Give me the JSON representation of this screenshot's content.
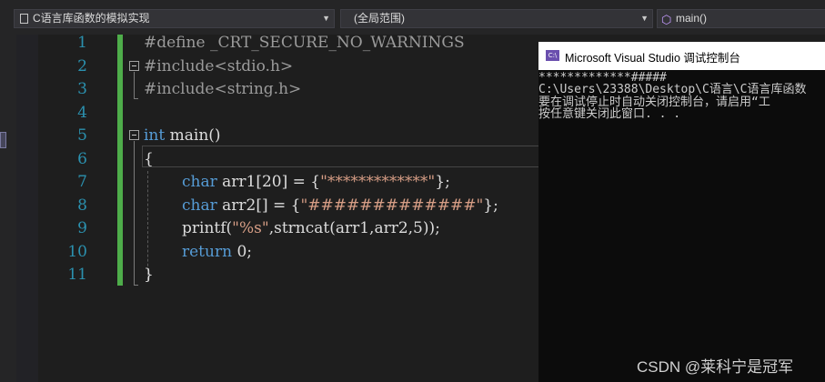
{
  "navbar": {
    "file_dropdown": "C语言库函数的模拟实现",
    "scope_dropdown": "(全局范围)",
    "function_dropdown": "main()"
  },
  "editor": {
    "line_numbers": [
      "1",
      "2",
      "3",
      "4",
      "5",
      "6",
      "7",
      "8",
      "9",
      "10",
      "11"
    ],
    "lines": {
      "l1": "#define _CRT_SECURE_NO_WARNINGS",
      "l2": "#include<stdio.h>",
      "l3": "#include<string.h>",
      "l5_kw": "int",
      "l5_rest": " main()",
      "l6": "{",
      "l7_kw": "char",
      "l7_a": " arr1[20] = {",
      "l7_str": "\"*************\"",
      "l7_b": "};",
      "l8_kw": "char",
      "l8_a": " arr2[] = {",
      "l8_str": "\"#############\"",
      "l8_b": "};",
      "l9_a": "printf(",
      "l9_str": "\"%s\"",
      "l9_b": ",strncat(arr1,arr2,5));",
      "l10_kw": "return",
      "l10_b": " 0;",
      "l11": "}"
    }
  },
  "console": {
    "title": "Microsoft Visual Studio 调试控制台",
    "output": [
      "*************#####",
      "C:\\Users\\23388\\Desktop\\C语言\\C语言库函数",
      "要在调试停止时自动关闭控制台，请启用“工",
      "按任意键关闭此窗口. . ."
    ]
  },
  "watermark": "CSDN @莱科宁是冠军"
}
